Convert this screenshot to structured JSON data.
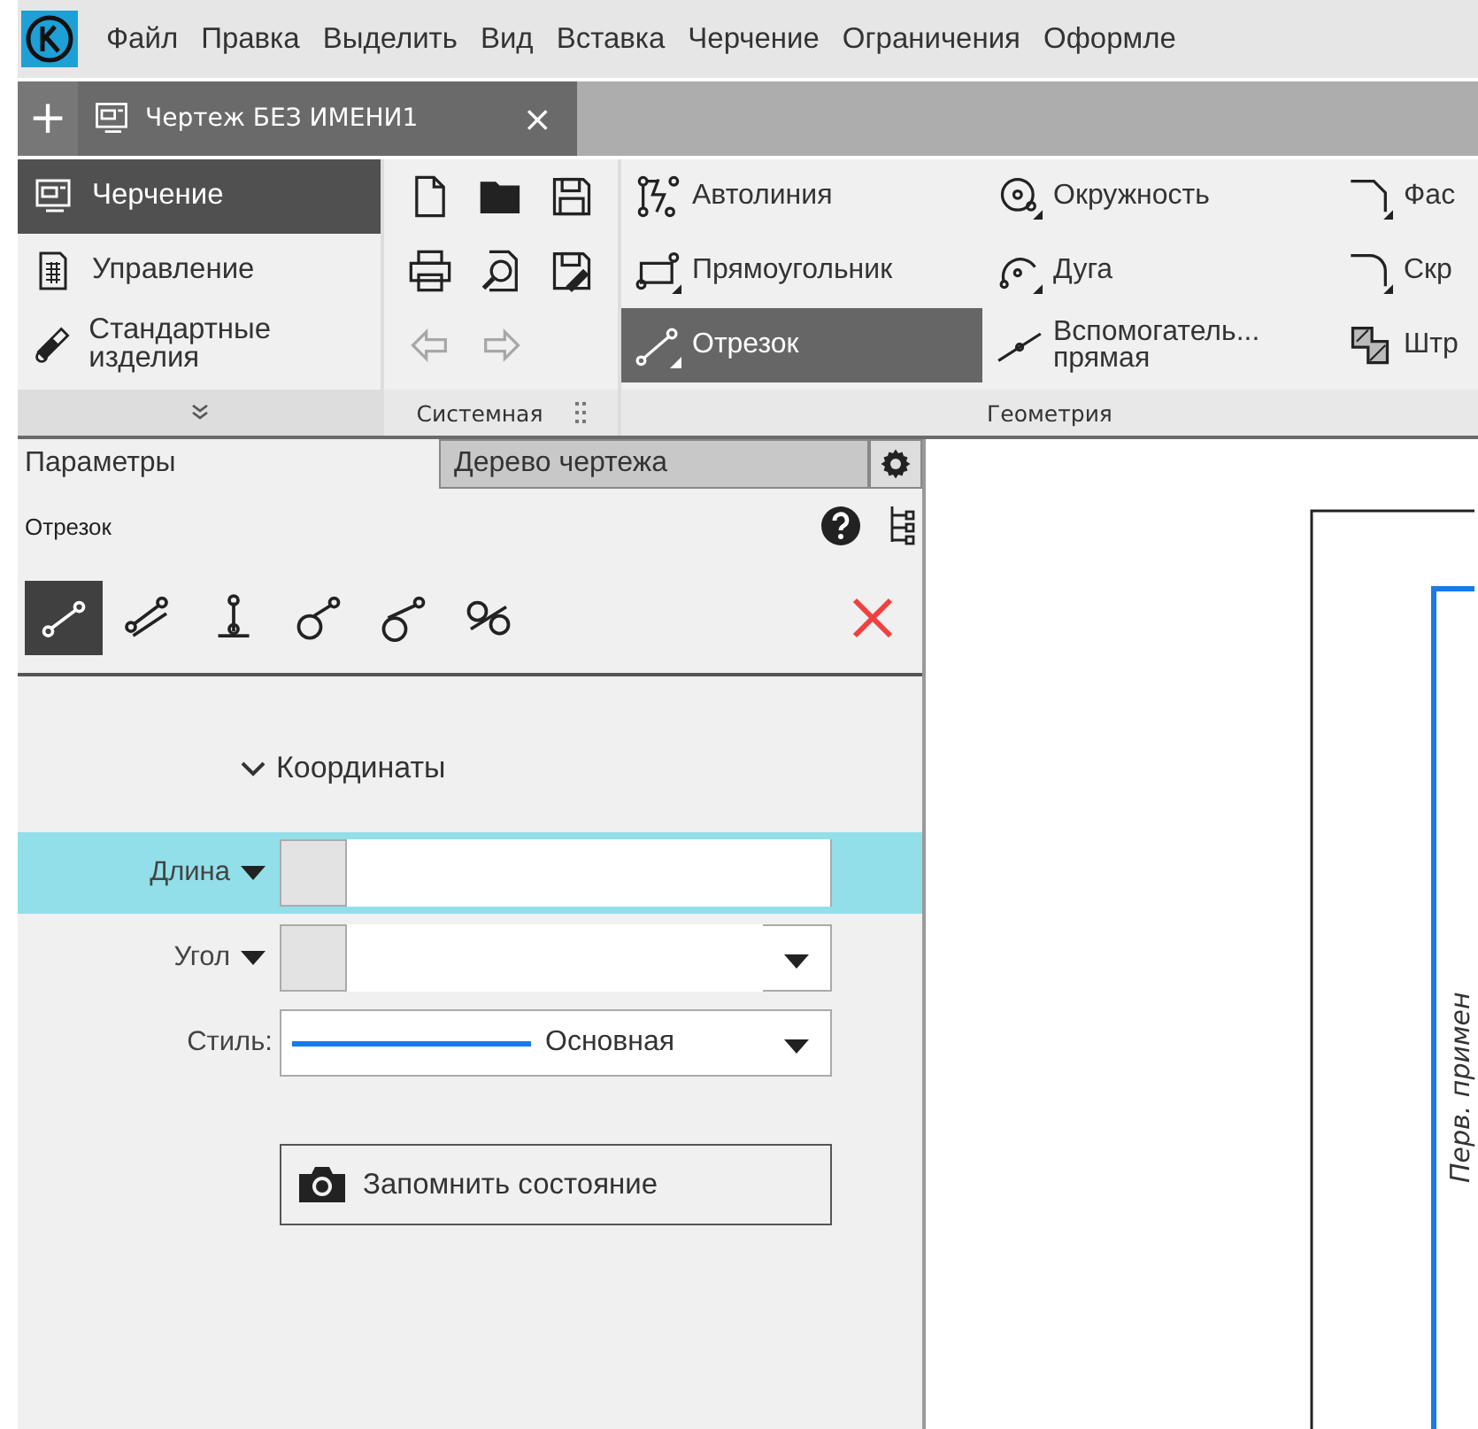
{
  "menu": [
    "Файл",
    "Правка",
    "Выделить",
    "Вид",
    "Вставка",
    "Черчение",
    "Ограничения",
    "Оформле"
  ],
  "document_tabs": {
    "add": "+",
    "tabs": [
      {
        "label": "Чертеж БЕЗ ИМЕНИ1",
        "selected": true,
        "close": "×"
      }
    ]
  },
  "ribbon": {
    "sections": [
      {
        "label": "Черчение",
        "selected": true
      },
      {
        "label": "Управление",
        "selected": false
      },
      {
        "label": "Стандартные изделия",
        "selected": false
      }
    ],
    "system_group": {
      "label": "Системная",
      "tools": [
        {
          "disabled": false
        },
        {
          "disabled": false
        },
        {
          "disabled": false
        },
        {
          "disabled": false
        },
        {
          "disabled": false
        },
        {
          "disabled": false
        },
        {
          "disabled": true
        },
        {
          "disabled": true
        }
      ]
    },
    "geometry_group": {
      "label": "Геометрия",
      "tools": [
        {
          "label": "Автолиния",
          "selected": false
        },
        {
          "label": "Прямоугольник",
          "selected": false
        },
        {
          "label": "Отрезок",
          "selected": true
        },
        {
          "label": "Окружность",
          "selected": false
        },
        {
          "label": "Дуга",
          "selected": false
        },
        {
          "label": "Вспомогатель... прямая",
          "selected": false
        },
        {
          "label": "Фас",
          "selected": false
        },
        {
          "label": "Скр",
          "selected": false
        },
        {
          "label": "Штр",
          "selected": false
        }
      ]
    }
  },
  "panel": {
    "tabs": [
      {
        "label": "Параметры",
        "selected": true
      },
      {
        "label": "Дерево чертежа",
        "selected": false
      }
    ],
    "command": "Отрезок",
    "modes": [
      {
        "selected": true
      },
      {
        "selected": false
      },
      {
        "selected": false
      },
      {
        "selected": false
      },
      {
        "selected": false
      },
      {
        "selected": false
      }
    ],
    "section": {
      "title": "Координаты",
      "expanded": true
    },
    "fields": [
      {
        "label": "Длина",
        "kind": "number",
        "selected": true
      },
      {
        "label": "Угол",
        "kind": "number_list",
        "selected": false
      },
      {
        "label": "Стиль:",
        "kind": "linestyle",
        "value": "Основная",
        "selected": false
      }
    ],
    "remember_button": "Запомнить состояние"
  },
  "canvas": {
    "stamp_text": "Перв. примен"
  }
}
